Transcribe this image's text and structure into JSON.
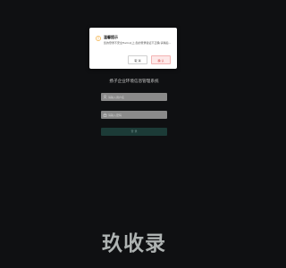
{
  "dialog": {
    "title": "温馨提示",
    "message": "您的登录不安全Hello以上,您的登录验证不正确,请稍后...",
    "cancel_label": "取 消",
    "confirm_label": "确 认",
    "icon": "warning-icon",
    "icon_color": "#f0a020"
  },
  "login": {
    "system_title": "扬子企业环境信息管理系统",
    "username_placeholder": "请输入用户名",
    "password_placeholder": "请输入密码",
    "submit_label": "登 录"
  },
  "watermark": {
    "text": "玖收录"
  },
  "colors": {
    "background": "#0f1012",
    "button_bg": "#1c3b37",
    "confirm_text": "#d23c3c"
  }
}
